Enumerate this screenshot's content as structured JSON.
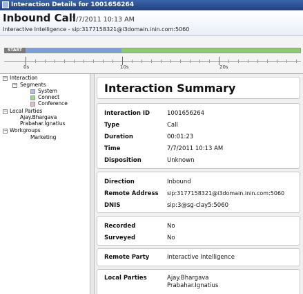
{
  "window": {
    "title": "Interaction Details for 1001656264"
  },
  "header": {
    "title": "Inbound Call",
    "date": "7/7/2011 10:13 AM",
    "subtitle": "Interactive Intelligence - sip:3177158321@i3domain.inin.com:5060"
  },
  "timeline": {
    "start_label": "START",
    "tick_labels": [
      "0s",
      "10s",
      "20s"
    ],
    "segments": [
      {
        "name": "System",
        "color": "#7d9fd9"
      },
      {
        "name": "Connect",
        "color": "#8acb74"
      }
    ]
  },
  "tree": {
    "root": "Interaction",
    "segments_label": "Segments",
    "segments": [
      {
        "label": "System",
        "color": "#a9c0e8"
      },
      {
        "label": "Connect",
        "color": "#98d68a"
      },
      {
        "label": "Conference",
        "color": "#e3b9d6"
      }
    ],
    "local_parties_label": "Local Parties",
    "local_parties": [
      "Ajay.Bhargava",
      "Prabahar.Ignatius"
    ],
    "workgroups_label": "Workgroups",
    "workgroups": [
      "Marketing"
    ]
  },
  "summary": {
    "title": "Interaction Summary",
    "general": [
      {
        "label": "Interaction ID",
        "value": "1001656264"
      },
      {
        "label": "Type",
        "value": "Call"
      },
      {
        "label": "Duration",
        "value": "00:01:23"
      },
      {
        "label": "Time",
        "value": "7/7/2011 10:13 AM"
      },
      {
        "label": "Disposition",
        "value": "Unknown"
      }
    ],
    "routing": [
      {
        "label": "Direction",
        "value": "Inbound"
      },
      {
        "label": "Remote Address",
        "value": "sip:3177158321@i3domain.inin.com:5060"
      },
      {
        "label": "DNIS",
        "value": "sip:3@sg-clay5:5060"
      }
    ],
    "recording": [
      {
        "label": "Recorded",
        "value": "No"
      },
      {
        "label": "Surveyed",
        "value": "No"
      }
    ],
    "remote_party": {
      "label": "Remote Party",
      "value": "Interactive Intelligence"
    },
    "local_parties": {
      "label": "Local Parties",
      "values": [
        "Ajay.Bhargava",
        "Prabahar.Ignatius"
      ]
    }
  }
}
